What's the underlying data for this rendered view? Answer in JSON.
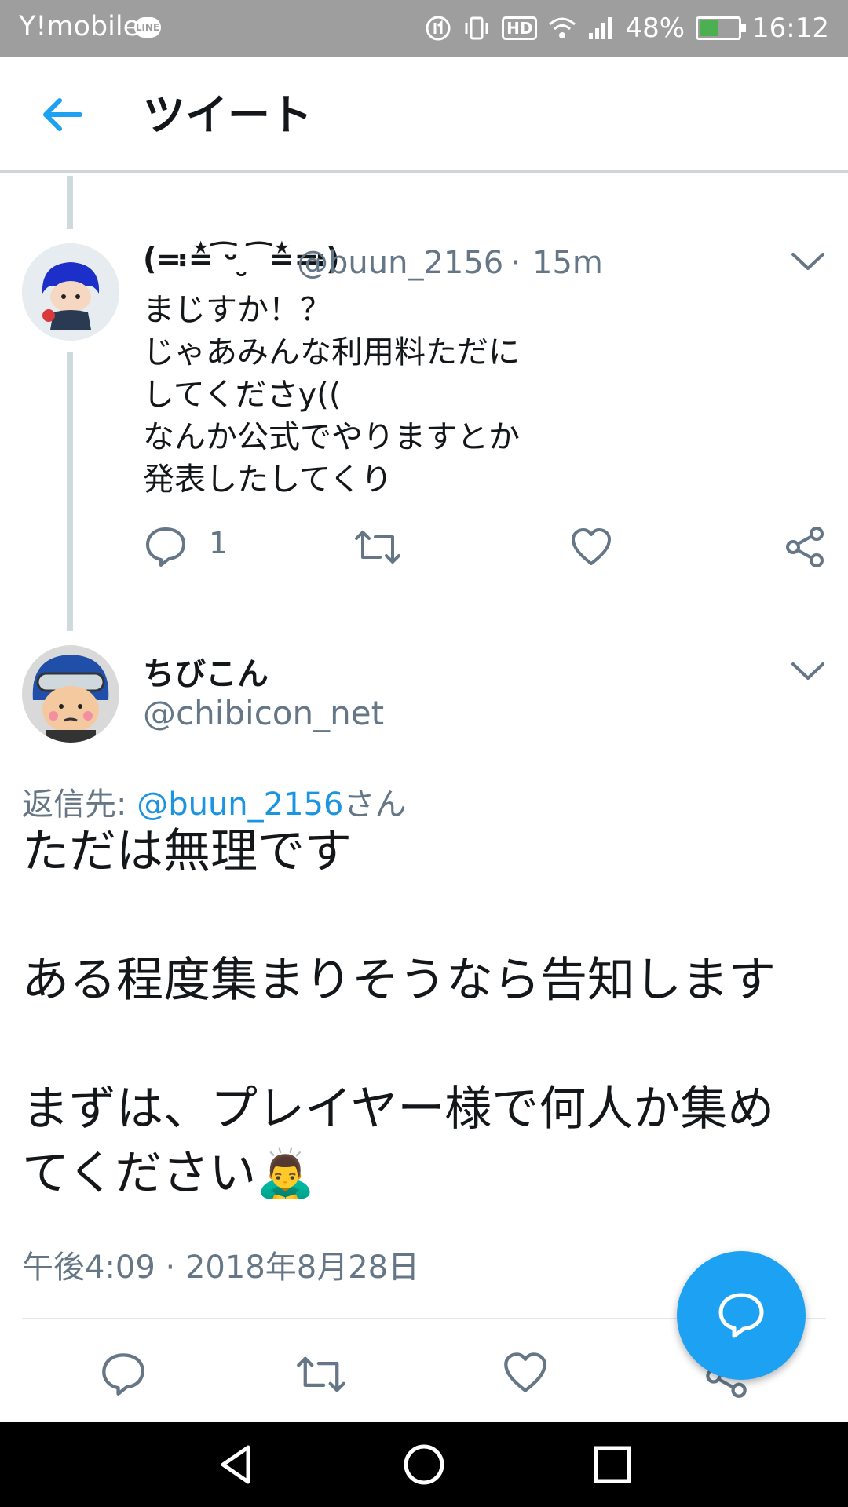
{
  "status_bar": {
    "carrier": "Y!mobile",
    "line_badge": "LINE",
    "hd": "HD",
    "battery": "48%",
    "battery_level": 0.48,
    "time": "16:12"
  },
  "header": {
    "title": "ツイート"
  },
  "tweet_parent": {
    "display_name": "(≕≛ ͡ᵕ ̮ ͡ ≛≕)",
    "handle": "@buun_2156",
    "separator": "·",
    "time": "15m",
    "text_lines": [
      "まじすか！？",
      "じゃあみんな利用料ただに",
      "してくださy((",
      "なんか公式でやりますとか",
      "発表したしてくり"
    ],
    "reply_count": "1"
  },
  "tweet_main": {
    "display_name": "ちびこん",
    "handle": "@chibicon_net",
    "reply_prefix": "返信先: ",
    "reply_mention": "@buun_2156",
    "reply_suffix": "さん",
    "text_line_1": "ただは無理です",
    "text_line_2": "ある程度集まりそうなら告知します",
    "text_line_3": "まずは、プレイヤー様で何人か集め",
    "text_line_4": "てください",
    "emoji": "🙇‍♂️",
    "timestamp": "午後4:09 · 2018年8月28日"
  },
  "colors": {
    "accent": "#1da1f2",
    "link": "#1b95e0",
    "secondary_text": "#657786",
    "primary_text": "#14171a",
    "thread_line": "#cfd9de",
    "status_bar": "#9e9e9e"
  },
  "icons": {
    "back": "arrow-left-icon",
    "caret": "chevron-down-icon",
    "reply": "speech-bubble-icon",
    "retweet": "retweet-icon",
    "like": "heart-icon",
    "share": "share-icon",
    "fab": "compose-reply-icon",
    "nav_back": "triangle-back-icon",
    "nav_home": "circle-home-icon",
    "nav_recents": "square-recents-icon"
  }
}
